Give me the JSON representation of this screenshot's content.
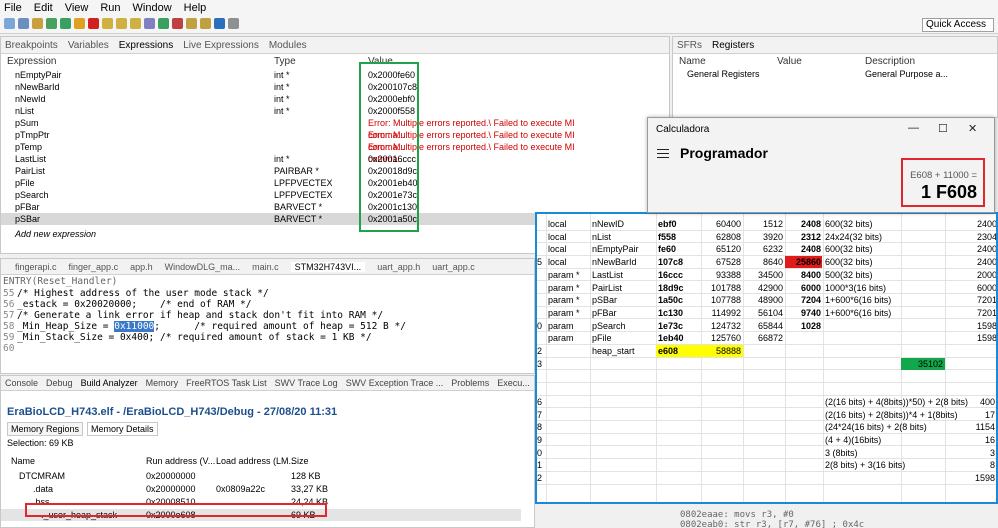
{
  "menu": [
    "File",
    "Edit",
    "View",
    "Run",
    "Window",
    "Help"
  ],
  "quick_access": "Quick Access",
  "expressions": {
    "tabs": [
      "Breakpoints",
      "Variables",
      "Expressions",
      "Live Expressions",
      "Modules"
    ],
    "headers": {
      "expression": "Expression",
      "type": "Type",
      "value": "Value"
    },
    "rows": [
      {
        "name": "nEmptyPair",
        "type": "int *",
        "value": "0x2000fe60",
        "error": false
      },
      {
        "name": "nNewBarId",
        "type": "int *",
        "value": "0x200107c8",
        "error": false
      },
      {
        "name": "nNewId",
        "type": "int *",
        "value": "0x2000ebf0",
        "error": false
      },
      {
        "name": "nList",
        "type": "int *",
        "value": "0x2000f558",
        "error": false
      },
      {
        "name": "pSum",
        "type": "",
        "value": "Error: Multiple errors reported.\\ Failed to execute MI comma...",
        "error": true
      },
      {
        "name": "pTmpPtr",
        "type": "",
        "value": "Error: Multiple errors reported.\\ Failed to execute MI comma...",
        "error": true
      },
      {
        "name": "pTemp",
        "type": "",
        "value": "Error: Multiple errors reported.\\ Failed to execute MI comma...",
        "error": true
      },
      {
        "name": "LastList",
        "type": "int *",
        "value": "0x20016ccc",
        "error": false
      },
      {
        "name": "PairList",
        "type": "PAIRBAR *",
        "value": "0x20018d9c",
        "error": false
      },
      {
        "name": "pFile",
        "type": "LPFPVECTEX",
        "value": "0x2001eb40",
        "error": false
      },
      {
        "name": "pSearch",
        "type": "LPFPVECTEX",
        "value": "0x2001e73c",
        "error": false
      },
      {
        "name": "pFBar",
        "type": "BARVECT *",
        "value": "0x2001c130",
        "error": false
      },
      {
        "name": "pSBar",
        "type": "BARVECT *",
        "value": "0x2001a50c",
        "error": false
      }
    ],
    "add_new": "Add new expression"
  },
  "registers": {
    "tabs": [
      "SFRs",
      "Registers"
    ],
    "headers": {
      "name": "Name",
      "value": "Value",
      "description": "Description"
    },
    "row": {
      "name": "General Registers",
      "description": "General Purpose a..."
    }
  },
  "editor": {
    "tabs": [
      "fingerapi.c",
      "finger_app.c",
      "app.h",
      "WindowDLG_ma...",
      "main.c",
      "STM32H743VI...",
      "uart_app.h",
      "uart_app.c"
    ],
    "lines": [
      {
        "n": "55",
        "pre": "",
        "code": "/* Highest address of the user mode stack */",
        "hl": "",
        "post": ""
      },
      {
        "n": "56",
        "pre": "",
        "code": "_estack = 0x20020000;    /* end of RAM */",
        "hl": "",
        "post": ""
      },
      {
        "n": "57",
        "pre": "",
        "code": "/* Generate a link error if heap and stack don't fit into RAM */",
        "hl": "",
        "post": ""
      },
      {
        "n": "58",
        "pre": "_Min_Heap_Size = ",
        "code": "",
        "hl": "0x11000",
        "post": ";      /* required amount of heap = 512 B */"
      },
      {
        "n": "59",
        "pre": "",
        "code": "_Min_Stack_Size = 0x400; /* required amount of stack = 1 KB */",
        "hl": "",
        "post": ""
      },
      {
        "n": "60",
        "pre": "",
        "code": "",
        "hl": "",
        "post": ""
      }
    ],
    "top_line": "ENTRY(Reset_Handler)"
  },
  "build": {
    "tabs": [
      "Console",
      "Debug",
      "Build Analyzer",
      "Memory",
      "FreeRTOS Task List",
      "SWV Trace Log",
      "SWV Exception Trace ...",
      "Problems",
      "Execu..."
    ],
    "title": "EraBioLCD_H743.elf - /EraBioLCD_H743/Debug - 27/08/20 11:31",
    "subtabs": [
      "Memory Regions",
      "Memory Details"
    ],
    "selection": "Selection: 69 KB",
    "headers": {
      "name": "Name",
      "run": "Run address (V...",
      "load": "Load address (LM...",
      "size": "Size"
    },
    "rows": [
      {
        "name": "DTCMRAM",
        "run": "0x20000000",
        "load": "",
        "size": "128 KB"
      },
      {
        "name": ".data",
        "run": "0x20000000",
        "load": "0x0809a22c",
        "size": "33,27 KB"
      },
      {
        "name": ".bss",
        "run": "0x20008510",
        "load": "",
        "size": "24,24 KB"
      },
      {
        "name": "._user_heap_stack",
        "run": "0x2000e608",
        "load": "",
        "size": "69 KB"
      }
    ]
  },
  "calculator": {
    "title": "Calculadora",
    "mode": "Programador",
    "expression": "E608 + 11000 =",
    "result": "1 F608"
  },
  "sheet": {
    "rows": [
      {
        "rn": "",
        "a": "local",
        "b": "nNewID",
        "c": "ebf0",
        "d": "60400",
        "e": "1512",
        "f": "2408",
        "g": "600(32 bits)",
        "h": "2400"
      },
      {
        "rn": "",
        "a": "local",
        "b": "nList",
        "c": "f558",
        "d": "62808",
        "e": "3920",
        "f": "2312",
        "g": "24x24(32 bits)",
        "h": "2304"
      },
      {
        "rn": "",
        "a": "local",
        "b": "nEmptyPair",
        "c": "fe60",
        "d": "65120",
        "e": "6232",
        "f": "2408",
        "g": "600(32 bits)",
        "h": "2400"
      },
      {
        "rn": "5",
        "a": "local",
        "b": "nNewBarId",
        "c": "107c8",
        "d": "67528",
        "e": "8640",
        "f": "25860",
        "g": "600(32 bits)",
        "h": "2400"
      },
      {
        "rn": "",
        "a": "param *",
        "b": "LastList",
        "c": "16ccc",
        "d": "93388",
        "e": "34500",
        "f": "8400",
        "g": "500(32 bits)",
        "h": "2000"
      },
      {
        "rn": "",
        "a": "param *",
        "b": "PairList",
        "c": "18d9c",
        "d": "101788",
        "e": "42900",
        "f": "6000",
        "g": "1000*3(16 bits)",
        "h": "6000"
      },
      {
        "rn": "",
        "a": "param *",
        "b": "pSBar",
        "c": "1a50c",
        "d": "107788",
        "e": "48900",
        "f": "7204",
        "g": "1+600*6(16 bits)",
        "h": "7201"
      },
      {
        "rn": "",
        "a": "param *",
        "b": "pFBar",
        "c": "1c130",
        "d": "114992",
        "e": "56104",
        "f": "9740",
        "g": "1+600*6(16 bits)",
        "h": "7201"
      },
      {
        "rn": "0",
        "a": "param",
        "b": "pSearch",
        "c": "1e73c",
        "d": "124732",
        "e": "65844",
        "f": "1028",
        "g": "",
        "h": "1598"
      },
      {
        "rn": "",
        "a": "param",
        "b": "pFile",
        "c": "1eb40",
        "d": "125760",
        "e": "66872",
        "f": "",
        "g": "",
        "h": "1598"
      },
      {
        "rn": "2",
        "a": "",
        "b": "heap_start",
        "c": "e608",
        "d": "58888",
        "e": "",
        "f": "",
        "g": "",
        "h": ""
      },
      {
        "rn": "3",
        "a": "",
        "b": "",
        "c": "",
        "d": "",
        "e": "",
        "f": "",
        "g": "",
        "h": "35102"
      },
      {
        "rn": "",
        "a": "",
        "b": "",
        "c": "",
        "d": "",
        "e": "",
        "f": "",
        "g": "",
        "h": ""
      },
      {
        "rn": "",
        "a": "",
        "b": "",
        "c": "",
        "d": "",
        "e": "",
        "f": "",
        "g": "",
        "h": ""
      },
      {
        "rn": "6",
        "a": "",
        "b": "",
        "c": "",
        "d": "",
        "e": "",
        "f": "",
        "g": "(2(16 bits) + 4(8bits))*50) + 2(8 bits)",
        "h": "400"
      },
      {
        "rn": "7",
        "a": "",
        "b": "",
        "c": "",
        "d": "",
        "e": "",
        "f": "",
        "g": "(2(16 bits) + 2(8bits))*4 + 1(8bits)",
        "h": "17"
      },
      {
        "rn": "8",
        "a": "",
        "b": "",
        "c": "",
        "d": "",
        "e": "",
        "f": "",
        "g": "(24*24(16 bits) + 2(8 bits)",
        "h": "1154"
      },
      {
        "rn": "9",
        "a": "",
        "b": "",
        "c": "",
        "d": "",
        "e": "",
        "f": "",
        "g": "(4 + 4)(16bits)",
        "h": "16"
      },
      {
        "rn": "0",
        "a": "",
        "b": "",
        "c": "",
        "d": "",
        "e": "",
        "f": "",
        "g": "3 (8bits)",
        "h": "3"
      },
      {
        "rn": "1",
        "a": "",
        "b": "",
        "c": "",
        "d": "",
        "e": "",
        "f": "",
        "g": "2(8 bits) + 3(16 bits)",
        "h": "8"
      },
      {
        "rn": "2",
        "a": "",
        "b": "",
        "c": "",
        "d": "",
        "e": "",
        "f": "",
        "g": "",
        "h": "1598"
      }
    ]
  },
  "asm": [
    "0802eaae:   movs    r3, #0",
    "0802eab0:   str     r3, [r7, #76]    ; 0x4c"
  ],
  "colors": {
    "green_box": "#1fa34a",
    "red_box": "#e2262d",
    "sheet_border": "#1b8ad6",
    "error_text": "#d20000"
  }
}
